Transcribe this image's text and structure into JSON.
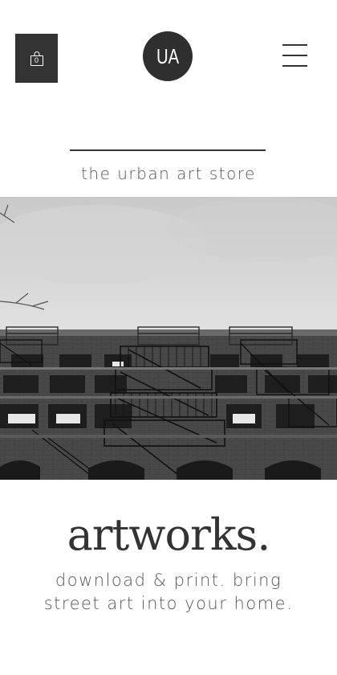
{
  "header": {
    "cart_count": "0",
    "logo_text": "UA"
  },
  "tagline": "the urban art store",
  "hero": {
    "icon": "building-fire-escape-photo"
  },
  "main": {
    "headline": "artworks.",
    "subtext_line1": "download & print. bring",
    "subtext_line2": "street art into your home."
  },
  "colors": {
    "dark": "#333333",
    "text_light": "#555555",
    "background": "#ffffff"
  }
}
